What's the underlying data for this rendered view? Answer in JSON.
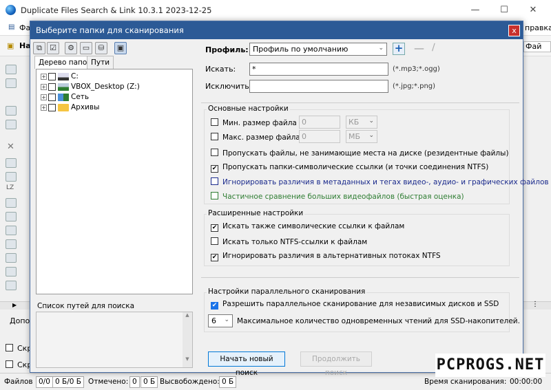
{
  "app": {
    "title": "Duplicate Files Search & Link 10.3.1 2023-12-25",
    "menu_fragment_left": "Фа",
    "menu_fragment_right": "правка",
    "toolbar_fragment_left": "На",
    "toolbar_fragment_right": "Фай",
    "left_fragment_1": "Допо",
    "left_fragment_2": "Скр",
    "left_fragment_3": "Скр"
  },
  "dialog": {
    "title": "Выберите папки для сканирования",
    "close_label": "x",
    "tabs": [
      "Дерево папок",
      "Пути"
    ],
    "tree": [
      {
        "label": "C:",
        "icon": "drive-icon"
      },
      {
        "label": "VBOX_Desktop (Z:)",
        "icon": "network-drive-icon"
      },
      {
        "label": "Сеть",
        "icon": "network-icon"
      },
      {
        "label": "Архивы",
        "icon": "folder-icon"
      }
    ],
    "pathlist_label": "Список путей для поиска",
    "profile_label": "Профиль:",
    "profile_value": "Профиль по умолчанию",
    "search_label": "Искать:",
    "search_value": "*",
    "search_hint": "(*.mp3;*.ogg)",
    "exclude_label": "Исключить:",
    "exclude_value": "",
    "exclude_hint": "(*.jpg;*.png)",
    "basic": {
      "title": "Основные настройки",
      "min_size_label": "Мин. размер файла",
      "min_size_value": "0",
      "min_size_unit": "КБ",
      "max_size_label": "Макс. размер файла",
      "max_size_value": "0",
      "max_size_unit": "МБ",
      "opt1": "Пропускать файлы, не занимающие места на диске (резидентные файлы)",
      "opt2": "Пропускать папки-символические ссылки (и точки соединения NTFS)",
      "opt3": "Игнорировать различия в метаданных и тегах видео-, аудио- и графических файлов",
      "opt4": "Частичное сравнение больших видеофайлов (быстрая оценка)"
    },
    "advanced": {
      "title": "Расширенные настройки",
      "opt1": "Искать также символические ссылки к файлам",
      "opt2": "Искать только NTFS-ссылки к файлам",
      "opt3": "Игнорировать различия в альтернативных потоках NTFS"
    },
    "parallel": {
      "title": "Настройки параллельного сканирования",
      "opt1": "Разрешить параллельное сканирование для независимых дисков и SSD",
      "threads_value": "6",
      "threads_label": "Максимальное количество одновременных чтений для SSD-накопителей."
    },
    "buttons": {
      "start": "Начать новый поиск",
      "continue": "Продолжить поиск"
    }
  },
  "status": {
    "files_label": "Файлов",
    "files_value": "0/0",
    "size_value": "0 Б/0 Б",
    "marked_label": "Отмечено:",
    "marked_count": "0",
    "marked_size": "0 Б",
    "freed_label": "Высвобождено:",
    "freed_value": "0 Б",
    "scan_time_label": "Время сканирования:",
    "scan_time_value": "00:00:00"
  },
  "watermark": "PCPROGS.NET",
  "colors": {
    "dialog_title_bg": "#2c5a96",
    "close_bg": "#c9302c",
    "accent_blue": "#1a73e8",
    "opt3_color": "#1a2a8c",
    "opt4_color": "#2e7d32"
  }
}
